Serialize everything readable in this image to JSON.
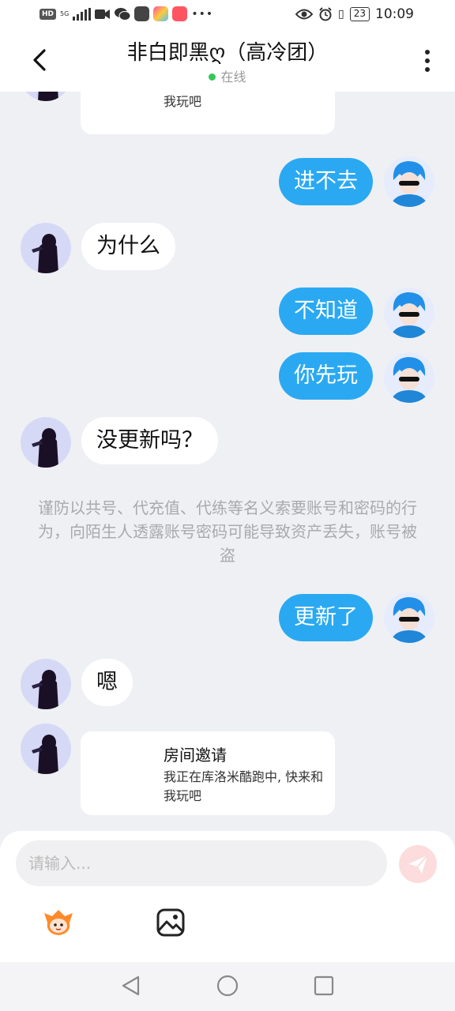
{
  "status_bar": {
    "hd": "HD",
    "net": "5G",
    "time": "10:09",
    "battery": "23"
  },
  "header": {
    "title": "非白即黑ღ（高冷团）",
    "status": "在线"
  },
  "messages": [
    {
      "side": "them",
      "type": "card",
      "desc": "我正在库洛米酷跑中, 快来和我玩吧"
    },
    {
      "side": "me",
      "text": "进不去"
    },
    {
      "side": "them",
      "text": "为什么"
    },
    {
      "side": "me",
      "text": "不知道"
    },
    {
      "side": "me",
      "text": "你先玩"
    },
    {
      "side": "them",
      "text": "没更新吗？"
    },
    {
      "side": "system",
      "text": "谨防以共号、代充值、代练等名义索要账号和密码的行为，向陌生人透露账号密码可能导致资产丢失，账号被盗"
    },
    {
      "side": "me",
      "text": "更新了"
    },
    {
      "side": "them",
      "text": "嗯"
    },
    {
      "side": "them",
      "type": "card",
      "title": "房间邀请",
      "desc": "我正在库洛米酷跑中, 快来和我玩吧"
    }
  ],
  "composer": {
    "placeholder": "请输入..."
  },
  "icons": {
    "back": "chevron-left-icon",
    "menu": "more-vertical-icon",
    "send": "send-icon",
    "sticker": "sticker-icon",
    "image": "image-icon",
    "nav_back": "triangle-back-icon",
    "nav_home": "circle-home-icon",
    "nav_recent": "square-recents-icon"
  },
  "colors": {
    "my_bubble": "#2aa9f2",
    "their_bubble": "#ffffff",
    "chat_bg": "#eff0f4",
    "online": "#35c759",
    "send_button": "#fcdcdc",
    "send_icon": "#ffffff"
  }
}
